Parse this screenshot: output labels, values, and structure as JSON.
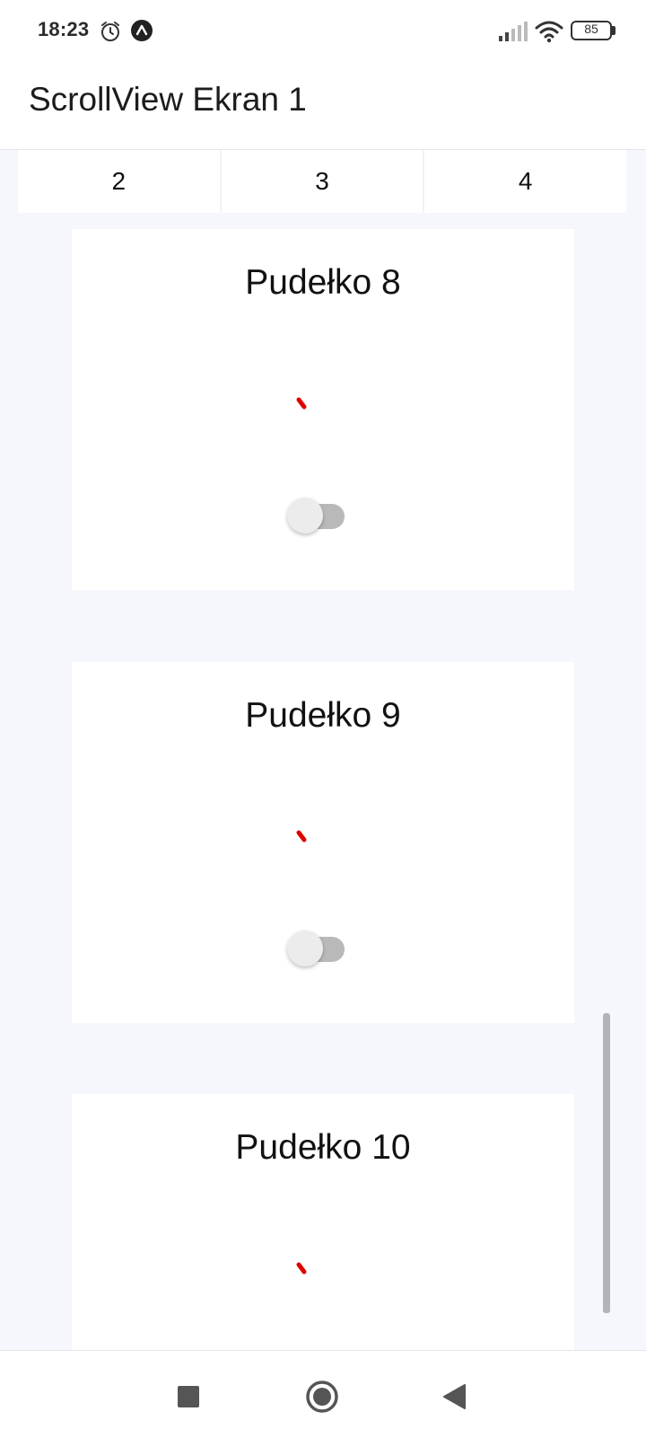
{
  "status_bar": {
    "time": "18:23",
    "battery": "85",
    "icons": [
      "alarm-icon",
      "app-notification-icon",
      "signal-icon",
      "wifi-icon",
      "battery-icon"
    ]
  },
  "header": {
    "title": "ScrollView Ekran 1"
  },
  "tabs": [
    {
      "label": "2"
    },
    {
      "label": "3"
    },
    {
      "label": "4"
    }
  ],
  "cards": [
    {
      "title": "Pudełko 8",
      "toggle_on": false
    },
    {
      "title": "Pudełko 9",
      "toggle_on": false
    },
    {
      "title": "Pudełko 10"
    }
  ],
  "navigation": {
    "icons": [
      "recent-apps-icon",
      "home-icon",
      "back-icon"
    ]
  },
  "colors": {
    "spinner": "#e00000",
    "background": "#f6f7fc",
    "card": "#ffffff"
  }
}
